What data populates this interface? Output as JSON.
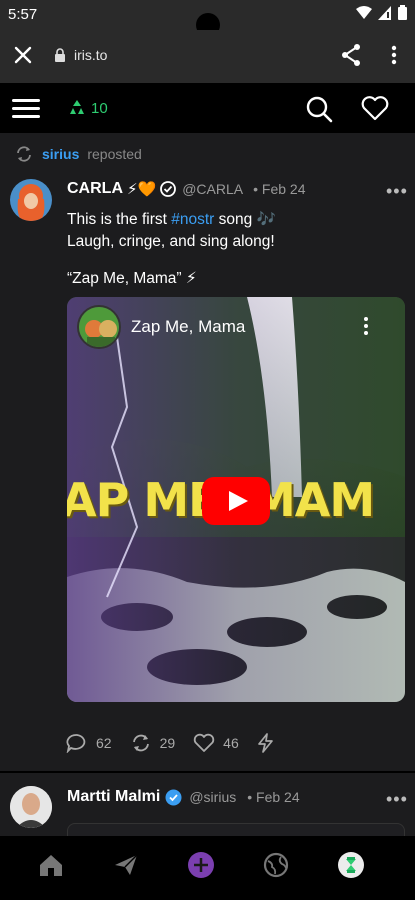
{
  "status_bar": {
    "time": "5:57"
  },
  "browser": {
    "url": "iris.to"
  },
  "header": {
    "relay_count": "10"
  },
  "repost": {
    "user": "sirius",
    "label": "reposted"
  },
  "post1": {
    "author": "CARLA",
    "author_emoji": "⚡🧡",
    "handle": "@CARLA",
    "date": "Feb 24",
    "text_before_tag": "This is the first ",
    "hashtag": "#nostr",
    "text_after_tag": " song 🎶",
    "text_line2": "Laugh, cringe, and sing along!",
    "song_title": "“Zap Me, Mama” ⚡",
    "video": {
      "title": "Zap Me, Mama",
      "overlay_text": "AP ME, MAM"
    },
    "actions": {
      "replies": "62",
      "reposts": "29",
      "likes": "46"
    }
  },
  "post2": {
    "author": "Martti Malmi",
    "handle": "@sirius",
    "date": "Feb 24"
  },
  "colors": {
    "accent_blue": "#3b9ef2",
    "relay_green": "#2ecc71",
    "nav_purple": "#7b3fb0"
  },
  "icons": [
    "close-icon",
    "lock-icon",
    "share-icon",
    "more-vertical-icon",
    "menu-icon",
    "relay-icon",
    "search-icon",
    "heart-icon",
    "repost-icon",
    "verified-icon",
    "reply-icon",
    "like-icon",
    "zap-icon",
    "home-icon",
    "send-icon",
    "plus-icon",
    "globe-icon",
    "profile-icon"
  ]
}
